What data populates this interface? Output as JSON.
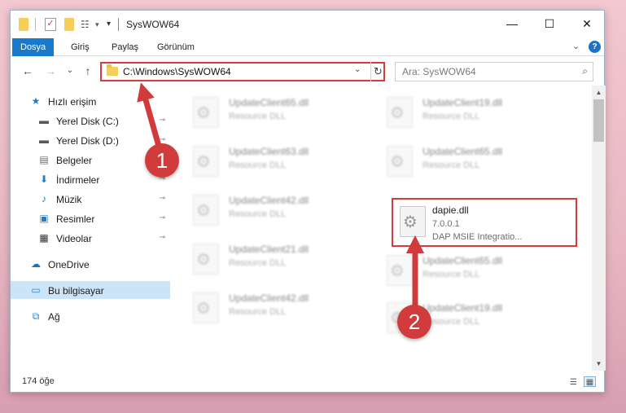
{
  "window": {
    "title": "SysWOW64",
    "controls": {
      "minimize": "—",
      "maximize": "☐",
      "close": "✕"
    }
  },
  "ribbon": {
    "tabs": [
      {
        "label": "Dosya",
        "active": true
      },
      {
        "label": "Giriş",
        "active": false
      },
      {
        "label": "Paylaş",
        "active": false
      },
      {
        "label": "Görünüm",
        "active": false
      }
    ],
    "expand": "⌄",
    "help": "?"
  },
  "address_bar": {
    "path": "C:\\Windows\\SysWOW64",
    "dropdown": "⌄",
    "refresh": "↻"
  },
  "search": {
    "placeholder": "Ara: SysWOW64",
    "icon": "⌕"
  },
  "nav_arrows": {
    "back": "←",
    "forward": "→",
    "recent": "⌄",
    "up": "↑"
  },
  "sidebar": {
    "items": [
      {
        "label": "Hızlı erişim",
        "icon": "★",
        "icon_name": "star-icon",
        "color": "#1e7ad2",
        "pinned": false
      },
      {
        "label": "Yerel Disk (C:)",
        "icon": "▬",
        "icon_name": "drive-icon",
        "color": "#5a5a5a",
        "pinned": true
      },
      {
        "label": "Yerel Disk (D:)",
        "icon": "▬",
        "icon_name": "drive-icon",
        "color": "#5a5a5a",
        "pinned": true
      },
      {
        "label": "Belgeler",
        "icon": "▤",
        "icon_name": "documents-icon",
        "color": "#6b6b6b",
        "pinned": true
      },
      {
        "label": "İndirmeler",
        "icon": "⬇",
        "icon_name": "downloads-icon",
        "color": "#1e7ad2",
        "pinned": true
      },
      {
        "label": "Müzik",
        "icon": "♪",
        "icon_name": "music-icon",
        "color": "#1e7ad2",
        "pinned": true
      },
      {
        "label": "Resimler",
        "icon": "▣",
        "icon_name": "pictures-icon",
        "color": "#2e7ab8",
        "pinned": true
      },
      {
        "label": "Videolar",
        "icon": "▦",
        "icon_name": "videos-icon",
        "color": "#333333",
        "pinned": true
      },
      {
        "label": "OneDrive",
        "icon": "☁",
        "icon_name": "onedrive-icon",
        "color": "#1e6fc4",
        "pinned": false
      },
      {
        "label": "Bu bilgisayar",
        "icon": "▭",
        "icon_name": "computer-icon",
        "color": "#2f84c9",
        "pinned": false,
        "selected": true
      },
      {
        "label": "Ağ",
        "icon": "⧉",
        "icon_name": "network-icon",
        "color": "#2f84c9",
        "pinned": false
      }
    ],
    "pin_glyph": "⊸"
  },
  "files": [
    {
      "name": "UpdateClient65.dll",
      "type": "Resource DLL"
    },
    {
      "name": "UpdateClient19.dll",
      "type": "Resource DLL"
    },
    {
      "name": "UpdateClient63.dll",
      "type": "Resource DLL"
    },
    {
      "name": "UpdateClient65.dll",
      "type": "Resource DLL"
    },
    {
      "name": "UpdateClient42.dll",
      "type": "Resource DLL"
    },
    {
      "name": "dapie.dll",
      "version": "7.0.0.1",
      "description": "DAP MSIE Integratio...",
      "highlighted": true
    },
    {
      "name": "UpdateClient21.dll",
      "type": "Resource DLL"
    },
    {
      "name": "UpdateClient65.dll",
      "type": "Resource DLL"
    },
    {
      "name": "UpdateClient42.dll",
      "type": "Resource DLL"
    },
    {
      "name": "UpdateClient19.dll",
      "type": "Resource DLL"
    }
  ],
  "status": {
    "item_count": "174 öğe",
    "view_details": "☰",
    "view_tiles": "▦"
  },
  "annotations": {
    "step1": "1",
    "step2": "2",
    "color": "#d13b3b"
  }
}
